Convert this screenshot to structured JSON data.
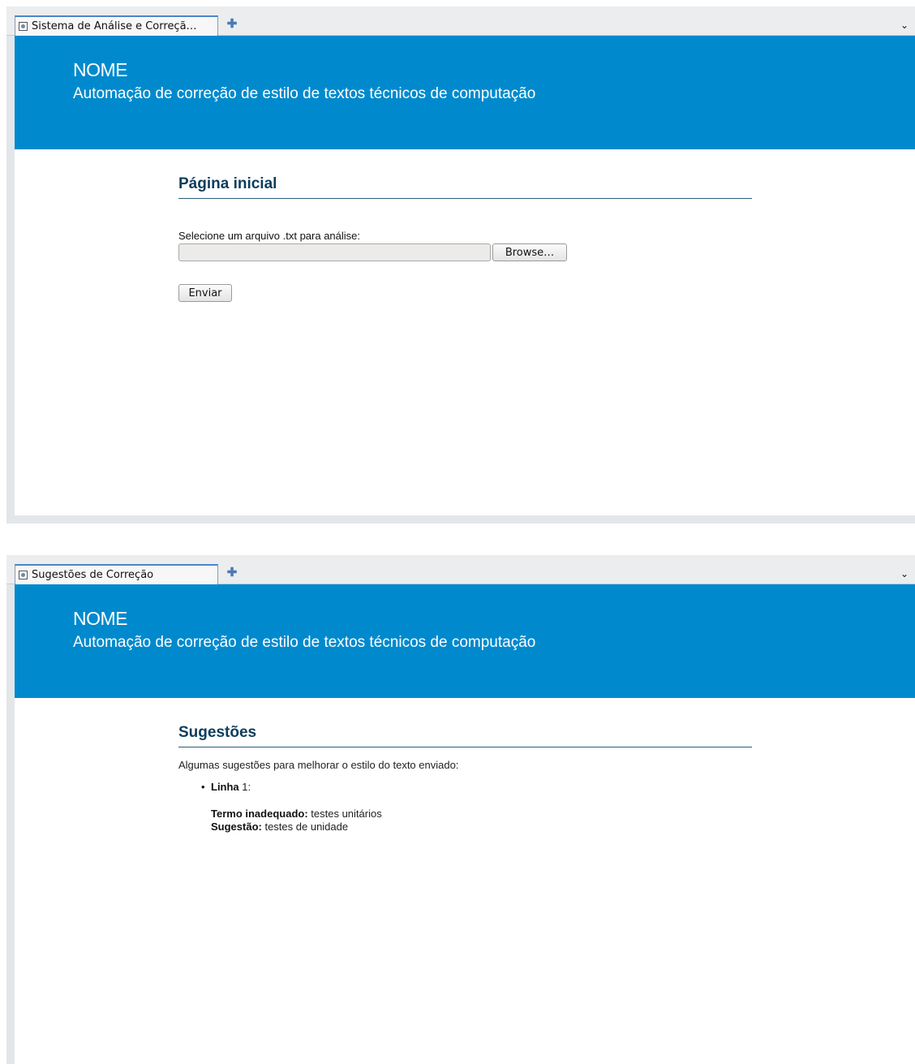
{
  "windows": [
    {
      "tab": {
        "title": "Sistema de Análise e Correçã…"
      },
      "header": {
        "site_name": "NOME",
        "tagline": "Automação de correção de estilo de textos técnicos de computação"
      },
      "page": {
        "heading": "Página inicial",
        "upload_label": "Selecione um arquivo .txt para análise:",
        "file_value": "",
        "browse_label": "Browse…",
        "submit_label": "Enviar"
      }
    },
    {
      "tab": {
        "title": "Sugestões de Correção"
      },
      "header": {
        "site_name": "NOME",
        "tagline": "Automação de correção de estilo de textos técnicos de computação"
      },
      "page": {
        "heading": "Sugestões",
        "intro": "Algumas sugestões para melhorar o estilo do texto enviado:",
        "suggestions": [
          {
            "line_label": "Linha",
            "line_number": "1:",
            "term_label": "Termo inadequado:",
            "term_value": "testes unitários",
            "suggestion_label": "Sugestão:",
            "suggestion_value": "testes de unidade"
          }
        ]
      }
    }
  ],
  "icons": {
    "new_tab": "plus-icon",
    "tab_list": "chevron-down-icon",
    "tab_page": "page-icon"
  },
  "colors": {
    "header_bg": "#008acd",
    "heading_text": "#0d3d5c",
    "tab_accent": "#4a86c8"
  }
}
